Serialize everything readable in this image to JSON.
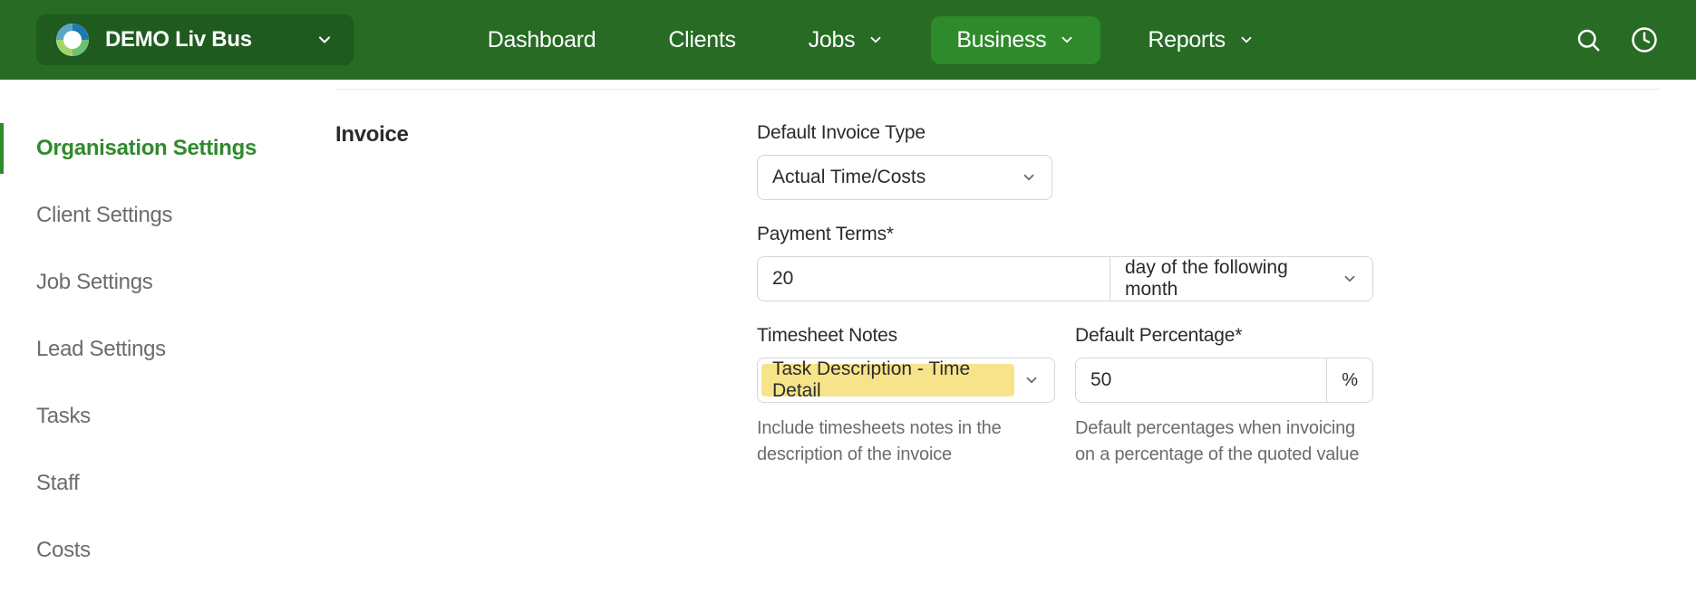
{
  "topbar": {
    "org_name": "DEMO Liv Bus",
    "nav": {
      "dashboard": "Dashboard",
      "clients": "Clients",
      "jobs": "Jobs",
      "business": "Business",
      "reports": "Reports"
    }
  },
  "sidebar": {
    "items": [
      "Organisation Settings",
      "Client Settings",
      "Job Settings",
      "Lead Settings",
      "Tasks",
      "Staff",
      "Costs"
    ]
  },
  "section": {
    "title": "Invoice"
  },
  "fields": {
    "default_invoice_type": {
      "label": "Default Invoice Type",
      "value": "Actual Time/Costs"
    },
    "payment_terms": {
      "label": "Payment Terms",
      "value": "20",
      "unit": "day of the following month"
    },
    "timesheet_notes": {
      "label": "Timesheet Notes",
      "value": "Task Description - Time Detail",
      "helper": "Include timesheets notes in the description of the invoice"
    },
    "default_percentage": {
      "label": "Default Percentage",
      "value": "50",
      "unit": "%",
      "helper": "Default percentages when invoicing on a percentage of the quoted value"
    }
  }
}
